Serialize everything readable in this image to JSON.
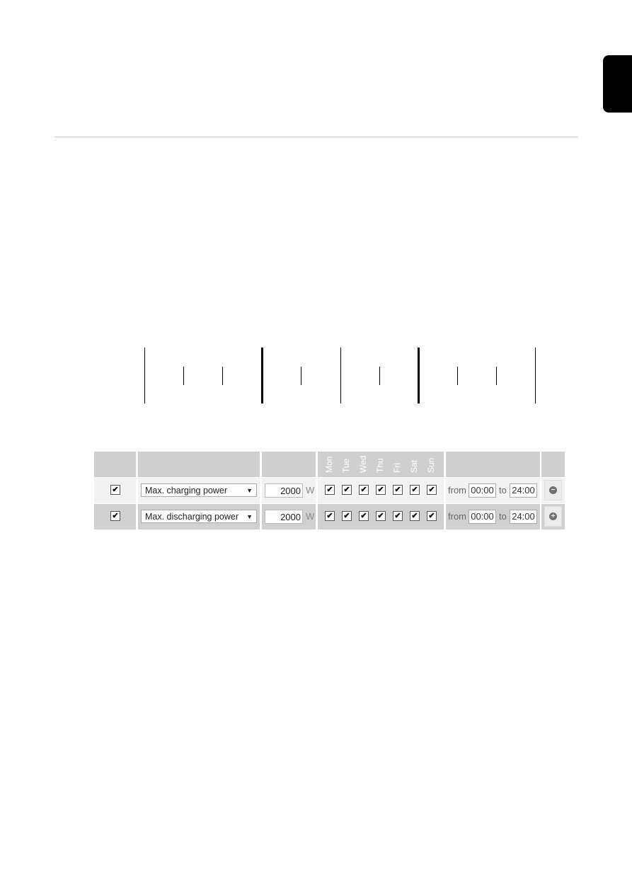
{
  "side_tab": {
    "label": ""
  },
  "schedule_table": {
    "header": {
      "days": [
        "Mon",
        "Tue",
        "Wed",
        "Thu",
        "Fri",
        "Sat",
        "Sun"
      ]
    },
    "rows": [
      {
        "enabled": true,
        "enabled_mark": "✔",
        "mode": "Max. charging power",
        "dropdown_arrow": "▼",
        "power": "2000",
        "unit": "W",
        "days_checked": [
          "✔",
          "✔",
          "✔",
          "✔",
          "✔",
          "✔",
          "✔"
        ],
        "from_label": "from",
        "from_time": "00:00",
        "to_label": "to",
        "to_time": "24:00",
        "action": "remove",
        "action_icon": "−"
      },
      {
        "enabled": true,
        "enabled_mark": "✔",
        "mode": "Max. discharging power",
        "dropdown_arrow": "▼",
        "power": "2000",
        "unit": "W",
        "days_checked": [
          "✔",
          "✔",
          "✔",
          "✔",
          "✔",
          "✔",
          "✔"
        ],
        "from_label": "from",
        "from_time": "00:00",
        "to_label": "to",
        "to_time": "24:00",
        "action": "add",
        "action_icon": "+"
      }
    ]
  }
}
